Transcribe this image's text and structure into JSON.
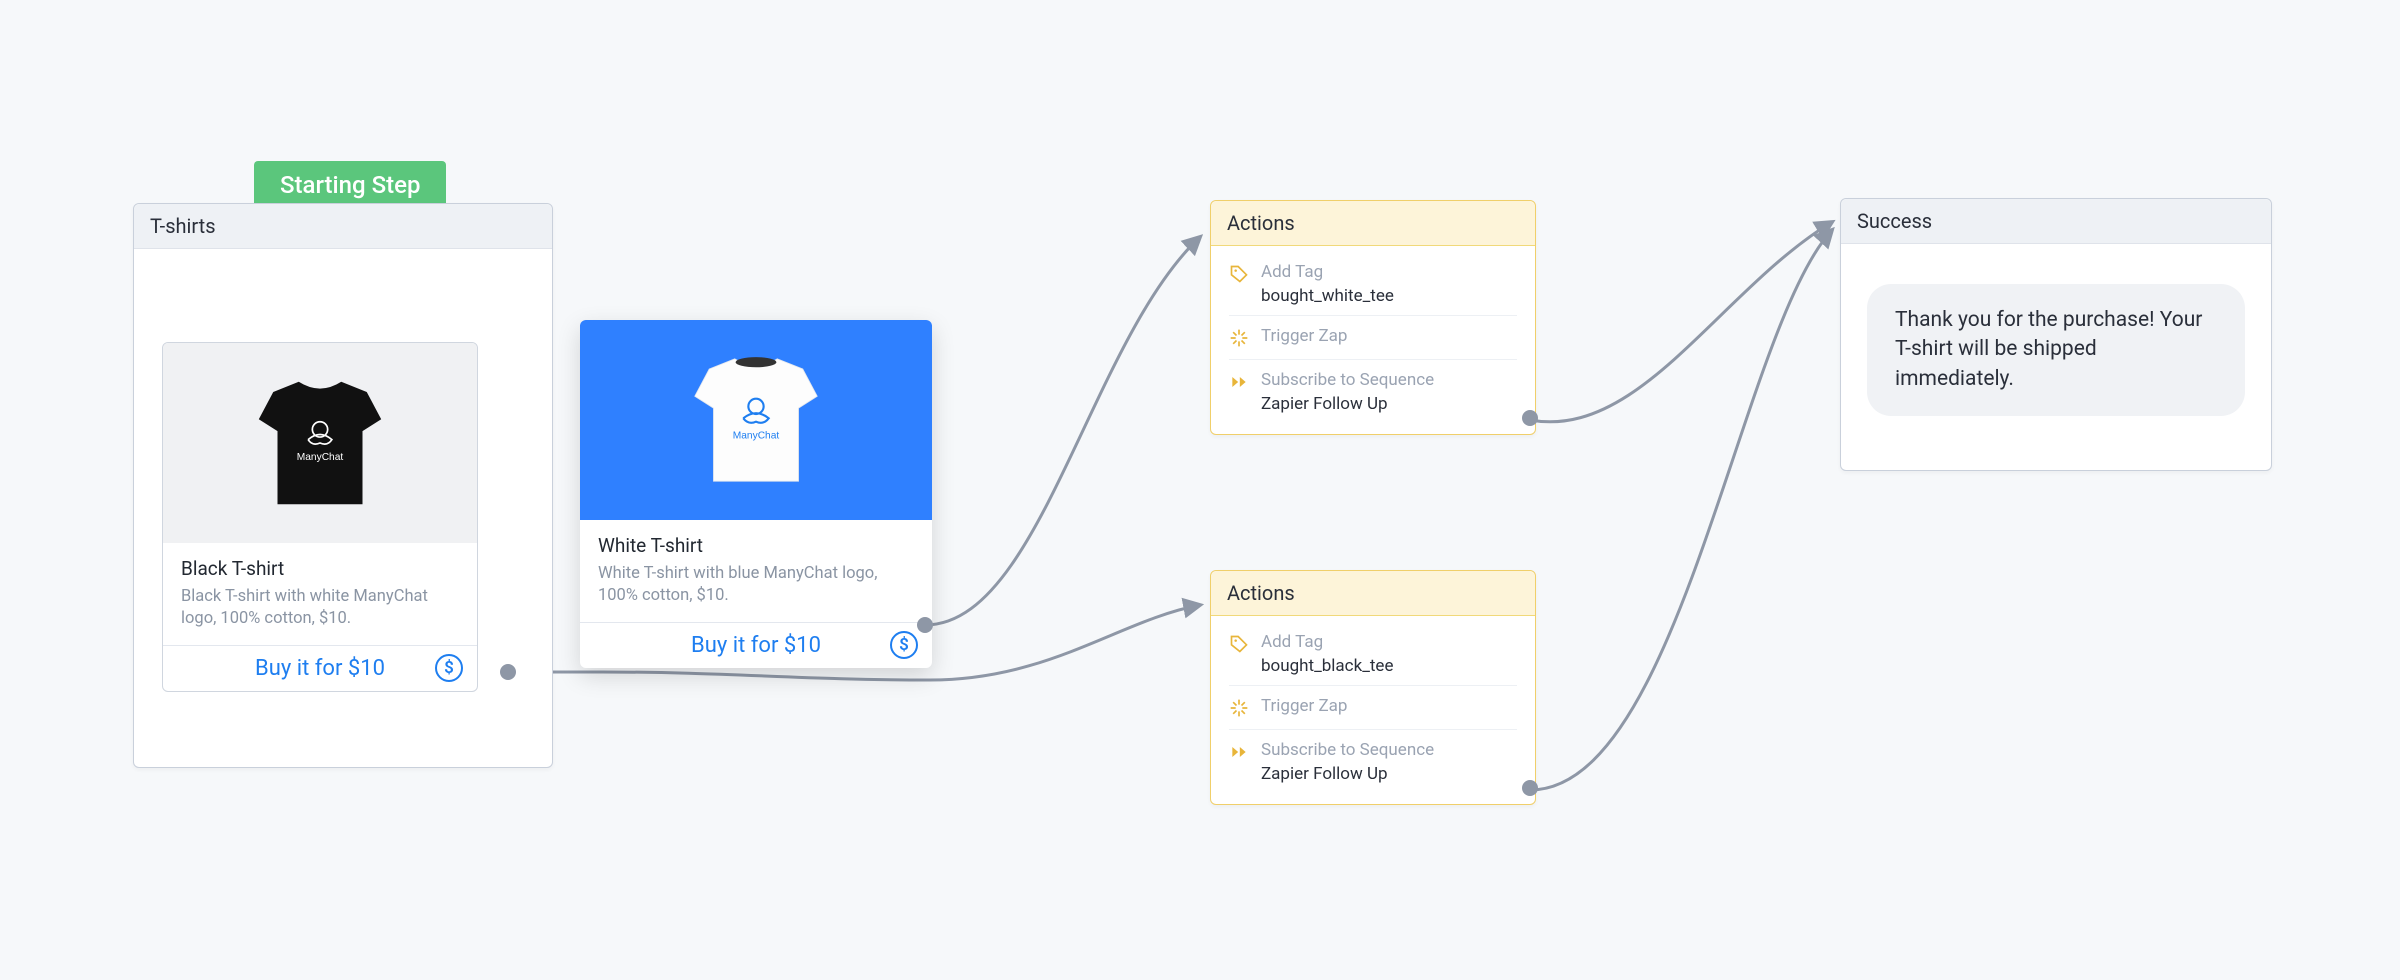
{
  "starting_step_label": "Starting Step",
  "tshirts_node": {
    "title": "T-shirts"
  },
  "black_product": {
    "title": "Black T-shirt",
    "description": "Black T-shirt with white ManyChat logo, 100% cotton, $10.",
    "buy_label": "Buy it for $10",
    "logo_text": "ManyChat"
  },
  "white_product": {
    "title": "White T-shirt",
    "description": "White T-shirt with blue ManyChat logo, 100% cotton, $10.",
    "buy_label": "Buy it for $10",
    "logo_text": "ManyChat"
  },
  "actions_top": {
    "title": "Actions",
    "items": [
      {
        "label": "Add Tag",
        "value": "bought_white_tee"
      },
      {
        "label": "Trigger Zap",
        "value": ""
      },
      {
        "label": "Subscribe to Sequence",
        "value": "Zapier Follow Up"
      }
    ]
  },
  "actions_bottom": {
    "title": "Actions",
    "items": [
      {
        "label": "Add Tag",
        "value": "bought_black_tee"
      },
      {
        "label": "Trigger Zap",
        "value": ""
      },
      {
        "label": "Subscribe to Sequence",
        "value": "Zapier Follow Up"
      }
    ]
  },
  "success_node": {
    "title": "Success",
    "message": "Thank you for the purchase! Your T-shirt will be shipped immediately."
  }
}
